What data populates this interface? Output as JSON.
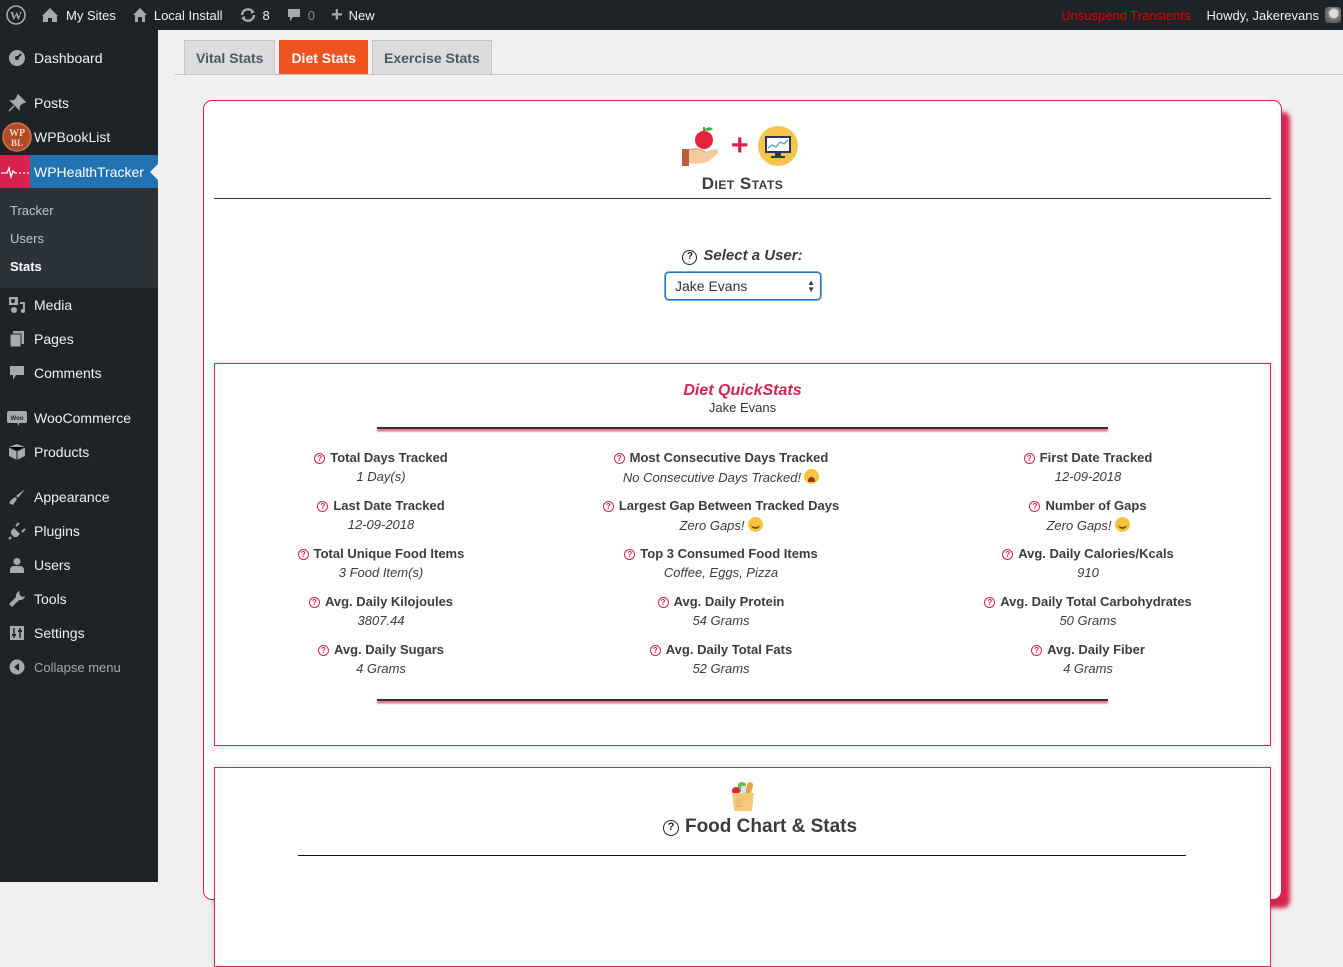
{
  "adminbar": {
    "my_sites": "My Sites",
    "site_name": "Local Install",
    "updates_count": "8",
    "comments_count": "0",
    "new_label": "New",
    "unsuspend_label": "Unsuspend Transients",
    "howdy": "Howdy, Jakerevans"
  },
  "sidebar": {
    "items": [
      {
        "label": "Dashboard",
        "icon": "dashboard-icon"
      },
      {
        "label": "Posts",
        "icon": "pin-icon"
      },
      {
        "label": "WPBookList",
        "icon": "wpbooklist-logo-icon"
      },
      {
        "label": "WPHealthTracker",
        "icon": "heartbeat-icon"
      },
      {
        "label": "Media",
        "icon": "media-icon"
      },
      {
        "label": "Pages",
        "icon": "pages-icon"
      },
      {
        "label": "Comments",
        "icon": "comment-icon"
      },
      {
        "label": "WooCommerce",
        "icon": "woo-icon"
      },
      {
        "label": "Products",
        "icon": "box-icon"
      },
      {
        "label": "Appearance",
        "icon": "brush-icon"
      },
      {
        "label": "Plugins",
        "icon": "plug-icon"
      },
      {
        "label": "Users",
        "icon": "user-icon"
      },
      {
        "label": "Tools",
        "icon": "wrench-icon"
      },
      {
        "label": "Settings",
        "icon": "settings-icon"
      }
    ],
    "submenu": [
      "Tracker",
      "Users",
      "Stats"
    ],
    "collapse_label": "Collapse menu"
  },
  "tabs": [
    {
      "label": "Vital Stats",
      "active": false
    },
    {
      "label": "Diet Stats",
      "active": true
    },
    {
      "label": "Exercise Stats",
      "active": false
    }
  ],
  "card": {
    "title": "Diet Stats",
    "select_label": "Select a User:",
    "selected_user": "Jake Evans"
  },
  "quickstats": {
    "title": "Diet QuickStats",
    "user": "Jake Evans",
    "stats": [
      {
        "label": "Total Days Tracked",
        "value": "1 Day(s)"
      },
      {
        "label": "Most Consecutive Days Tracked",
        "value": "No Consecutive Days Tracked!",
        "emoji": "sad"
      },
      {
        "label": "First Date Tracked",
        "value": "12-09-2018"
      },
      {
        "label": "Last Date Tracked",
        "value": "12-09-2018"
      },
      {
        "label": "Largest Gap Between Tracked Days",
        "value": "Zero Gaps!",
        "emoji": "smile"
      },
      {
        "label": "Number of Gaps",
        "value": "Zero Gaps!",
        "emoji": "smile"
      },
      {
        "label": "Total Unique Food Items",
        "value": "3 Food Item(s)"
      },
      {
        "label": "Top 3 Consumed Food Items",
        "value": "Coffee, Eggs, Pizza"
      },
      {
        "label": "Avg. Daily Calories/Kcals",
        "value": "910"
      },
      {
        "label": "Avg. Daily Kilojoules",
        "value": "3807.44"
      },
      {
        "label": "Avg. Daily Protein",
        "value": "54 Grams"
      },
      {
        "label": "Avg. Daily Total Carbohydrates",
        "value": "50 Grams"
      },
      {
        "label": "Avg. Daily Sugars",
        "value": "4 Grams"
      },
      {
        "label": "Avg. Daily Total Fats",
        "value": "52 Grams"
      },
      {
        "label": "Avg. Daily Fiber",
        "value": "4 Grams"
      }
    ]
  },
  "food_chart": {
    "title": "Food Chart & Stats"
  },
  "colors": {
    "accent": "#d9234f",
    "active_tab": "#f0541e",
    "admin_bg": "#1d2327",
    "menu_current": "#2271b1",
    "unsuspend": "#e00000"
  }
}
